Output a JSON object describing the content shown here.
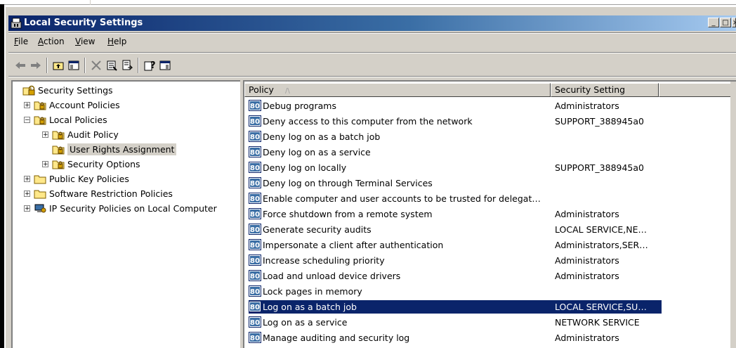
{
  "window": {
    "title": "Local Security Settings",
    "min": "_",
    "max": "□",
    "close": "×"
  },
  "menu": [
    {
      "label": "File",
      "u": "F",
      "rest": "ile"
    },
    {
      "label": "Action",
      "u": "A",
      "rest": "ction"
    },
    {
      "label": "View",
      "u": "V",
      "rest": "iew"
    },
    {
      "label": "Help",
      "u": "H",
      "rest": "elp"
    }
  ],
  "toolbar": [
    "back-icon",
    "forward-icon",
    "up-folder-icon",
    "show-hide-tree-icon",
    "delete-icon",
    "properties-icon",
    "export-list-icon",
    "help-icon",
    "console-icon"
  ],
  "tree": {
    "root": "Security Settings",
    "items": [
      {
        "label": "Account Policies",
        "level": 1,
        "expander": "+"
      },
      {
        "label": "Local Policies",
        "level": 1,
        "expander": "−"
      },
      {
        "label": "Audit Policy",
        "level": 2,
        "expander": "+"
      },
      {
        "label": "User Rights Assignment",
        "level": 2,
        "expander": "",
        "selected": true
      },
      {
        "label": "Security Options",
        "level": 2,
        "expander": "+"
      },
      {
        "label": "Public Key Policies",
        "level": 1,
        "expander": "+"
      },
      {
        "label": "Software Restriction Policies",
        "level": 1,
        "expander": "+"
      },
      {
        "label": "IP Security Policies on Local Computer",
        "level": 1,
        "expander": "+",
        "icon": "ip-security-icon"
      }
    ]
  },
  "list": {
    "columns": {
      "policy": "Policy",
      "sort": "/\\",
      "setting": "Security Setting"
    },
    "rows": [
      {
        "policy": "Debug programs",
        "setting": "Administrators"
      },
      {
        "policy": "Deny access to this computer from the network",
        "setting": "SUPPORT_388945a0"
      },
      {
        "policy": "Deny log on as a batch job",
        "setting": ""
      },
      {
        "policy": "Deny log on as a service",
        "setting": ""
      },
      {
        "policy": "Deny log on locally",
        "setting": "SUPPORT_388945a0"
      },
      {
        "policy": "Deny log on through Terminal Services",
        "setting": ""
      },
      {
        "policy": "Enable computer and user accounts to be trusted for delegat…",
        "setting": ""
      },
      {
        "policy": "Force shutdown from a remote system",
        "setting": "Administrators"
      },
      {
        "policy": "Generate security audits",
        "setting": "LOCAL SERVICE,NE…"
      },
      {
        "policy": "Impersonate a client after authentication",
        "setting": "Administrators,SER…"
      },
      {
        "policy": "Increase scheduling priority",
        "setting": "Administrators"
      },
      {
        "policy": "Load and unload device drivers",
        "setting": "Administrators"
      },
      {
        "policy": "Lock pages in memory",
        "setting": ""
      },
      {
        "policy": "Log on as a batch job",
        "setting": "LOCAL SERVICE,SU…",
        "selected": true
      },
      {
        "policy": "Log on as a service",
        "setting": "NETWORK SERVICE"
      },
      {
        "policy": "Manage auditing and security log",
        "setting": "Administrators"
      }
    ]
  },
  "colors": {
    "titlebar_start": "#0a246a",
    "titlebar_end": "#a6caf0",
    "selection": "#0a246a",
    "chrome": "#d4d0c8"
  }
}
